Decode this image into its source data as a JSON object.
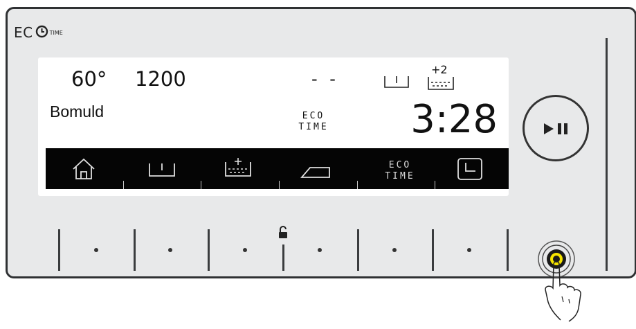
{
  "brand": {
    "ec": "EC",
    "time": "TIME"
  },
  "display": {
    "temperature": "60°",
    "spin_speed": "1200",
    "option_value": "- -",
    "program": "Bomuld",
    "ecotime_top": "ECO",
    "ecotime_bottom": "TIME",
    "remaining_time": "3:28",
    "extra_rinse_count": "+2"
  },
  "iconbar": {
    "items": [
      {
        "name": "home-icon"
      },
      {
        "name": "prewash-icon"
      },
      {
        "name": "extra-rinse-icon"
      },
      {
        "name": "iron-icon"
      },
      {
        "name": "eco-time",
        "top": "ECO",
        "bottom": "TIME"
      },
      {
        "name": "delay-start-icon"
      }
    ]
  },
  "colors": {
    "panel": "#e8e9ea",
    "border": "#2f3133",
    "screen": "#ffffff",
    "bar": "#050505",
    "power_accent": "#f5e400"
  }
}
